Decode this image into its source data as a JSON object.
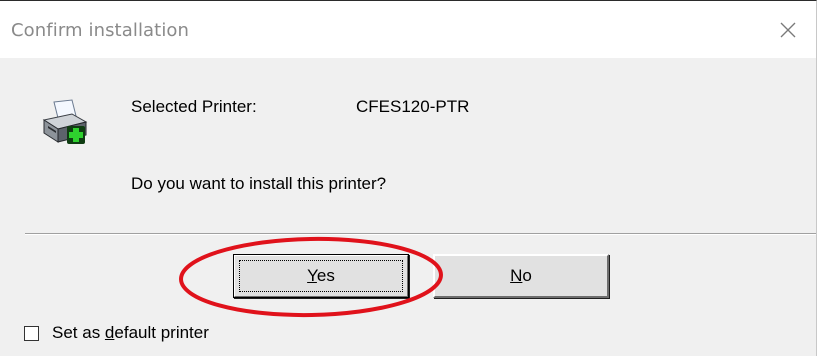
{
  "window": {
    "title": "Confirm installation",
    "close_icon": "close-icon"
  },
  "body": {
    "printer_icon": "printer-add-icon",
    "selected_label": "Selected Printer:",
    "printer_name": "CFES120-PTR",
    "question": "Do you want to install this printer?"
  },
  "buttons": {
    "yes": {
      "mnemonic": "Y",
      "rest": "es"
    },
    "no": {
      "mnemonic": "N",
      "rest": "o"
    }
  },
  "checkbox": {
    "checked": false,
    "before": "Set as ",
    "mnemonic": "d",
    "after": "efault printer"
  },
  "annotation": {
    "type": "red-ellipse-highlight",
    "color": "#e0121b"
  },
  "colors": {
    "dialog_bg": "#f0f0f0",
    "titlebar_bg": "#ffffff",
    "button_bg": "#e1e1e1",
    "annotation": "#e0121b"
  }
}
